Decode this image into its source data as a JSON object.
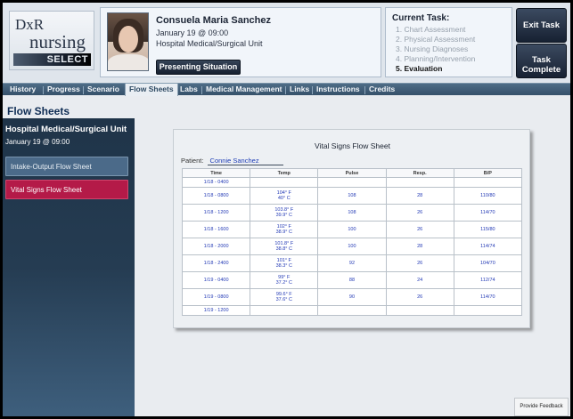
{
  "logo": {
    "dxr": "DxR",
    "nursing": "nursing",
    "select": "SELECT"
  },
  "patient": {
    "name": "Consuela Maria Sanchez",
    "date": "January 19 @ 09:00",
    "unit": "Hospital Medical/Surgical Unit",
    "presenting_label": "Presenting Situation"
  },
  "current_task": {
    "title": "Current Task:",
    "steps": [
      "1.  Chart Assessment",
      "2.  Physical Assessment",
      "3.  Nursing Diagnoses",
      "4.  Planning/Intervention",
      "5.  Evaluation"
    ],
    "active_step": 5
  },
  "buttons": {
    "exit_task": "Exit Task",
    "task_complete_1": "Task",
    "task_complete_2": "Complete",
    "feedback": "Provide Feedback"
  },
  "nav": {
    "items": [
      "History",
      "Progress",
      "Scenario",
      "Flow Sheets",
      "Labs",
      "Medical Management",
      "Links",
      "Instructions",
      "Credits"
    ],
    "active": "Flow Sheets"
  },
  "page_title": "Flow Sheets",
  "sidebar": {
    "unit": "Hospital Medical/Surgical Unit",
    "date": "January 19 @ 09:00",
    "links": [
      "Intake-Output Flow Sheet",
      "Vital Signs Flow Sheet"
    ],
    "active_link": "Vital Signs Flow Sheet"
  },
  "flow_sheet": {
    "title": "Vital Signs Flow Sheet",
    "patient_label": "Patient:",
    "patient_name": "Connie Sanchez",
    "columns": [
      "Time",
      "Temp",
      "Pulse",
      "Resp.",
      "B/P"
    ],
    "rows": [
      {
        "time": "1/18 - 0400",
        "temp_f": "",
        "temp_c": "",
        "pulse": "",
        "resp": "",
        "bp": ""
      },
      {
        "time": "1/18 - 0800",
        "temp_f": "104° F",
        "temp_c": "40° C",
        "pulse": "108",
        "resp": "28",
        "bp": "110/80"
      },
      {
        "time": "1/18 - 1200",
        "temp_f": "103.8° F",
        "temp_c": "39.9° C",
        "pulse": "108",
        "resp": "26",
        "bp": "114/70"
      },
      {
        "time": "1/18 - 1600",
        "temp_f": "102° F",
        "temp_c": "38.9° C",
        "pulse": "100",
        "resp": "26",
        "bp": "115/80"
      },
      {
        "time": "1/18 - 2000",
        "temp_f": "101.8° F",
        "temp_c": "38.8° C",
        "pulse": "100",
        "resp": "28",
        "bp": "114/74"
      },
      {
        "time": "1/18 - 2400",
        "temp_f": "101° F",
        "temp_c": "38.3° C",
        "pulse": "92",
        "resp": "26",
        "bp": "104/70"
      },
      {
        "time": "1/19 - 0400",
        "temp_f": "99° F",
        "temp_c": "37.2° C",
        "pulse": "88",
        "resp": "24",
        "bp": "112/74"
      },
      {
        "time": "1/19 - 0800",
        "temp_f": "99.6° F",
        "temp_c": "37.6° C",
        "pulse": "90",
        "resp": "26",
        "bp": "114/70"
      },
      {
        "time": "1/19 - 1200",
        "temp_f": "",
        "temp_c": "",
        "pulse": "",
        "resp": "",
        "bp": ""
      }
    ]
  },
  "colors": {
    "nav_bar": "#3f5c77",
    "sidebar": "#243a50",
    "active_link": "#b41a48",
    "table_text": "#2138b5",
    "title": "#0f2d54"
  }
}
